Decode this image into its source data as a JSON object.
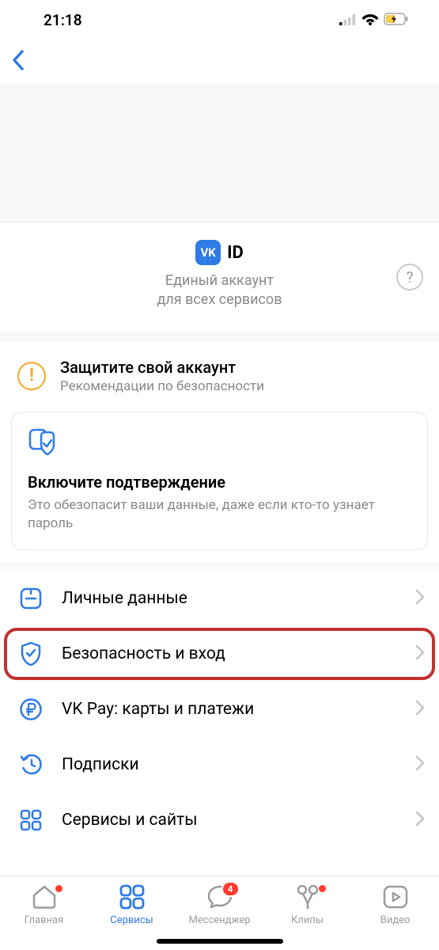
{
  "status": {
    "time": "21:18"
  },
  "vkid": {
    "logo_letters": "VK",
    "id_label": "ID",
    "subtitle_line1": "Единый аккаунт",
    "subtitle_line2": "для всех сервисов"
  },
  "protect": {
    "title": "Защитите свой аккаунт",
    "subtitle": "Рекомендации по безопасности"
  },
  "card": {
    "title": "Включите подтверждение",
    "subtitle": "Это обезопасит ваши данные, даже если кто-то узнает пароль"
  },
  "menu": {
    "personal": "Личные данные",
    "security": "Безопасность и вход",
    "vkpay": "VK Pay: карты и платежи",
    "subscriptions": "Подписки",
    "services": "Сервисы и сайты"
  },
  "tabs": {
    "home": "Главная",
    "services": "Сервисы",
    "messenger": "Мессенджер",
    "clips": "Клипы",
    "video": "Видео",
    "messenger_badge": "4"
  }
}
